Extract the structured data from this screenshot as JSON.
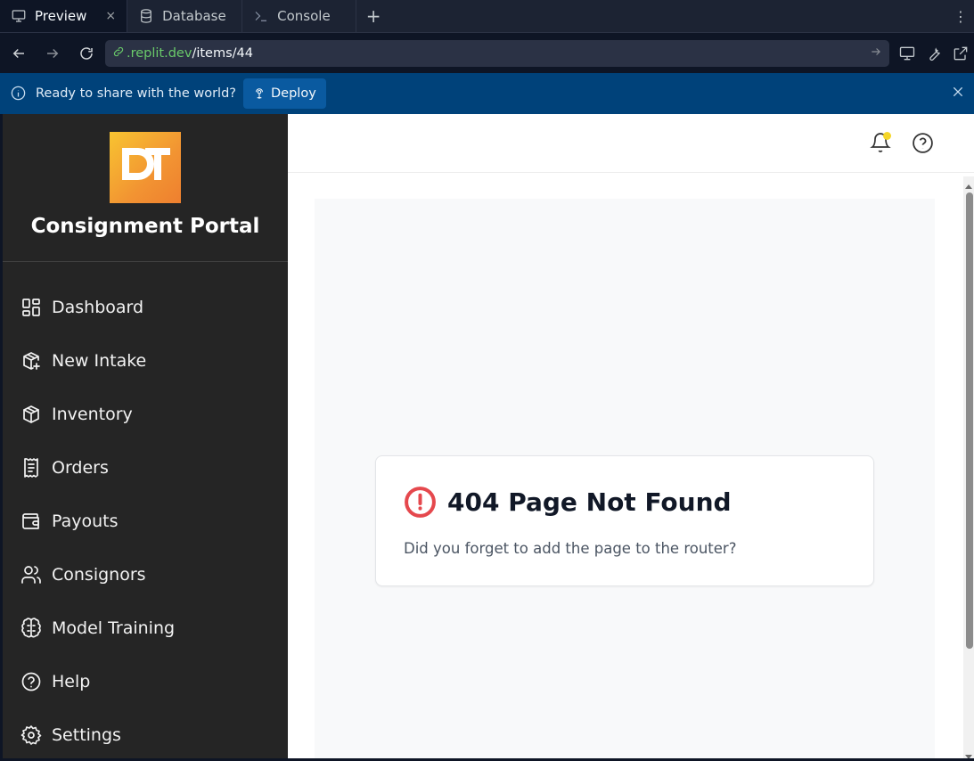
{
  "tabs": [
    {
      "label": "Preview",
      "icon": "monitor-icon",
      "active": true,
      "close": "×"
    },
    {
      "label": "Database",
      "icon": "database-icon",
      "active": false
    },
    {
      "label": "Console",
      "icon": "terminal-icon",
      "active": false
    }
  ],
  "tab_add": "+",
  "tab_more": "⋮",
  "url": {
    "domain": ".replit.dev",
    "path": "/items/44"
  },
  "banner": {
    "message": "Ready to share with the world?",
    "deploy_label": "Deploy",
    "bg_color": "#00427a"
  },
  "app": {
    "brand": "Consignment Portal",
    "logo_text": "DT",
    "nav": [
      {
        "label": "Dashboard",
        "icon": "dashboard-icon"
      },
      {
        "label": "New Intake",
        "icon": "package-plus-icon"
      },
      {
        "label": "Inventory",
        "icon": "package-icon"
      },
      {
        "label": "Orders",
        "icon": "receipt-icon"
      },
      {
        "label": "Payouts",
        "icon": "wallet-icon"
      },
      {
        "label": "Consignors",
        "icon": "users-icon"
      },
      {
        "label": "Model Training",
        "icon": "brain-icon"
      },
      {
        "label": "Help",
        "icon": "help-circle-icon"
      },
      {
        "label": "Settings",
        "icon": "settings-icon"
      }
    ],
    "error": {
      "title": "404 Page Not Found",
      "message": "Did you forget to add the page to the router?",
      "icon_color": "#e5484d"
    }
  },
  "colors": {
    "sidebar_bg": "#252525",
    "content_bg": "#f8f9fa",
    "url_domain": "#6aca6a",
    "notification_dot": "#f5d629"
  }
}
